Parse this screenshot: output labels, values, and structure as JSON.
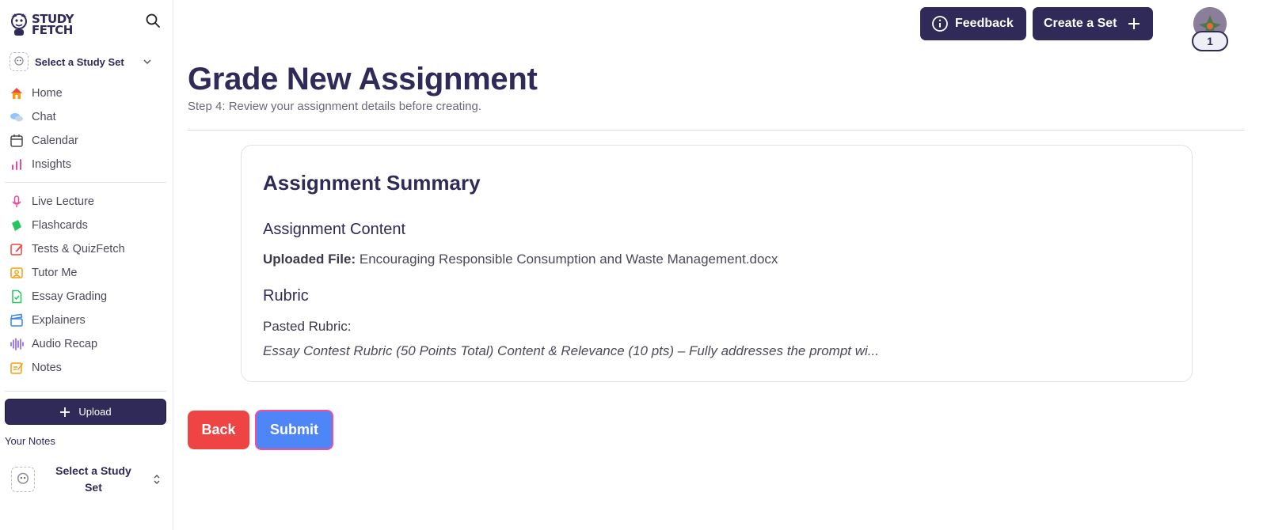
{
  "brand": {
    "line1": "STUDY",
    "line2": "FETCH"
  },
  "sidebar": {
    "study_set_select": "Select a Study Set",
    "nav_primary": [
      {
        "label": "Home",
        "icon": "home-icon",
        "color": "#f59e0b"
      },
      {
        "label": "Chat",
        "icon": "chat-icon",
        "color": "#60a5fa"
      },
      {
        "label": "Calendar",
        "icon": "calendar-icon",
        "color": "#4a4a5a"
      },
      {
        "label": "Insights",
        "icon": "insights-icon",
        "color": "#ec4899"
      }
    ],
    "nav_secondary": [
      {
        "label": "Live Lecture",
        "icon": "microphone-icon",
        "color": "#ec4899"
      },
      {
        "label": "Flashcards",
        "icon": "flashcards-icon",
        "color": "#22c55e"
      },
      {
        "label": "Tests & QuizFetch",
        "icon": "pencil-icon",
        "color": "#ef4444"
      },
      {
        "label": "Tutor Me",
        "icon": "tutor-icon",
        "color": "#f59e0b"
      },
      {
        "label": "Essay Grading",
        "icon": "document-check-icon",
        "color": "#22c55e"
      },
      {
        "label": "Explainers",
        "icon": "clapperboard-icon",
        "color": "#3b82f6"
      },
      {
        "label": "Audio Recap",
        "icon": "audio-wave-icon",
        "color": "#8b5cf6"
      },
      {
        "label": "Notes",
        "icon": "notes-icon",
        "color": "#f59e0b"
      }
    ],
    "upload_label": "Upload",
    "your_notes_label": "Your Notes",
    "notes_select_line1": "Select a Study",
    "notes_select_line2": "Set"
  },
  "header": {
    "feedback_label": "Feedback",
    "create_set_label": "Create a Set",
    "profile_badge": "1"
  },
  "main": {
    "title": "Grade New Assignment",
    "subtitle": "Step 4: Review your assignment details before creating.",
    "summary": {
      "title": "Assignment Summary",
      "content_heading": "Assignment Content",
      "uploaded_file_label": "Uploaded File:",
      "uploaded_file_name": "Encouraging Responsible Consumption and Waste Management.docx",
      "rubric_heading": "Rubric",
      "pasted_rubric_label": "Pasted Rubric:",
      "rubric_preview": "Essay Contest Rubric (50 Points Total) Content & Relevance (10 pts) – Fully addresses the prompt wi..."
    },
    "back_label": "Back",
    "submit_label": "Submit"
  },
  "colors": {
    "brand_dark": "#2f2a58",
    "back": "#ef4444",
    "submit": "#4f86f7",
    "submit_border": "#f0509a"
  }
}
